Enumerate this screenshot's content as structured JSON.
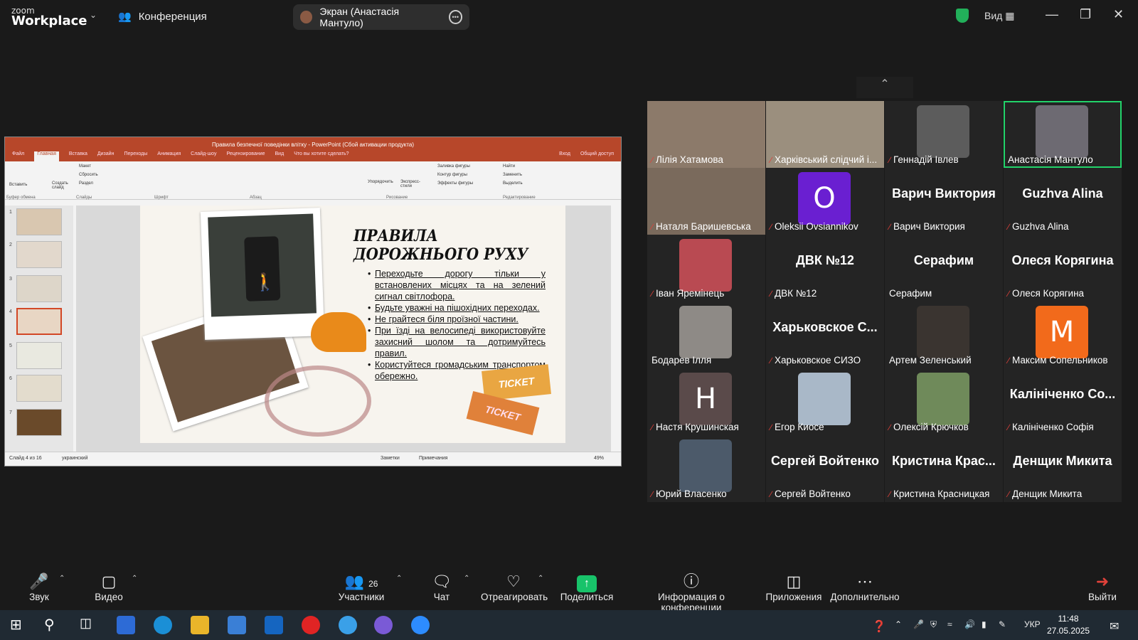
{
  "topbar": {
    "logo_top": "zoom",
    "logo_bottom": "Workplace",
    "conference_label": "Конференция",
    "share_label": "Экран (Анастасія Мантуло)",
    "view_label": "Вид"
  },
  "ppt": {
    "title": "Правила безпечної поведінки влітку - PowerPoint (Сбой активации продукта)",
    "tabs": [
      "Файл",
      "Главная",
      "Вставка",
      "Дизайн",
      "Переходы",
      "Анимация",
      "Слайд-шоу",
      "Рецензирование",
      "Вид",
      "Что вы хотите сделать?"
    ],
    "right_tabs": [
      "Вход",
      "Общий доступ"
    ],
    "groups": [
      "Буфер обмена",
      "Слайды",
      "Шрифт",
      "Абзац",
      "Рисование",
      "Редактирование"
    ],
    "ribbon_items": [
      "Вставить",
      "Создать слайд",
      "Макет",
      "Сбросить",
      "Раздел",
      "Упорядочить",
      "Экспресс-стили",
      "Заливка фигуры",
      "Контур фигуры",
      "Эффекты фигуры",
      "Найти",
      "Заменить",
      "Выделить"
    ],
    "thumb_numbers": [
      "1",
      "2",
      "3",
      "4",
      "5",
      "6",
      "7"
    ],
    "slide": {
      "title": "ПРАВИЛА ДОРОЖНЬОГО РУХУ",
      "bullets": [
        "Переходьте дорогу тільки у встановлених місцях та на зелений сигнал світлофора.",
        "Будьте уважні на пішохідних переходах.",
        "Не грайтеся біля проїзної частини.",
        "При їзді на велосипеді використовуйте захисний шолом та дотримуйтесь правил.",
        "Користуйтеся громадським транспортом обережно."
      ],
      "ticket1": "TICKET",
      "ticket2": "TICKET"
    },
    "status": {
      "slide_of": "Слайд 4 из 16",
      "language": "украинский",
      "notes": "Заметки",
      "comments": "Примечания",
      "zoom": "49%"
    }
  },
  "gallery": [
    {
      "name": "Лілія Хатамова",
      "type": "photo",
      "color": "#8c7a6a",
      "muted": true
    },
    {
      "name": "Харківський слідчий і...",
      "type": "photo",
      "color": "#9b8f7e",
      "muted": true
    },
    {
      "name": "Геннадій Івлев",
      "type": "photo_sq",
      "color": "#5c5c5c",
      "muted": true
    },
    {
      "name": "Анастасія Мантуло",
      "type": "photo_sq",
      "color": "#6d6a72",
      "muted": false,
      "active": true
    },
    {
      "name": "Наталя Баришевська",
      "type": "photo",
      "color": "#7a6a5c",
      "muted": true
    },
    {
      "name": "Oleksii Ovsiannikov",
      "type": "letter",
      "letter": "O",
      "color": "#6a1fd1",
      "muted": true
    },
    {
      "name": "Варич Виктория",
      "type": "text",
      "big": "Варич Виктория",
      "muted": true
    },
    {
      "name": "Guzhva Alina",
      "type": "text",
      "big": "Guzhva Alina",
      "muted": true
    },
    {
      "name": "Іван Яремінець",
      "type": "photo_sq",
      "color": "#b94a52",
      "muted": true
    },
    {
      "name": "ДВК №12",
      "type": "text",
      "big": "ДВК №12",
      "muted": true
    },
    {
      "name": "Серафим",
      "type": "text",
      "big": "Серафим",
      "muted": false
    },
    {
      "name": "Олеся Корягина",
      "type": "text",
      "big": "Олеся Корягина",
      "muted": true
    },
    {
      "name": "Бодарев Ілля",
      "type": "photo_sq",
      "color": "#8e8a86",
      "muted": false
    },
    {
      "name": "Харьковское СИЗО",
      "type": "text",
      "big": "Харьковское С...",
      "muted": true
    },
    {
      "name": "Артем Зеленський",
      "type": "photo_sq",
      "color": "#3a3430",
      "muted": false
    },
    {
      "name": "Максим Сопельников",
      "type": "letter",
      "letter": "M",
      "color": "#f26a1b",
      "muted": true
    },
    {
      "name": "Настя Крушинская",
      "type": "letter",
      "letter": "H",
      "color": "#5a4a4a",
      "muted": true
    },
    {
      "name": "Егор Киосе",
      "type": "photo_sq",
      "color": "#a9b8c8",
      "muted": true
    },
    {
      "name": "Олексій Крючков",
      "type": "photo_sq",
      "color": "#6f8a5a",
      "muted": true
    },
    {
      "name": "Калініченко Софія",
      "type": "text",
      "big": "Калініченко Со...",
      "muted": true
    },
    {
      "name": "Юрий Власенко",
      "type": "photo_sq",
      "color": "#4c5a6a",
      "muted": true
    },
    {
      "name": "Сергей Войтенко",
      "type": "text",
      "big": "Сергей Войтенко",
      "muted": true
    },
    {
      "name": "Кристина Красницкая",
      "type": "text",
      "big": "Кристина Крас...",
      "muted": true
    },
    {
      "name": "Денщик Микита",
      "type": "text",
      "big": "Денщик Микита",
      "muted": true
    }
  ],
  "toolbar": {
    "audio": "Звук",
    "video": "Видео",
    "participants": "Участники",
    "participants_count": "26",
    "chat": "Чат",
    "react": "Отреагировать",
    "share": "Поделиться",
    "info": "Информация о конференции",
    "apps": "Приложения",
    "more": "Дополнительно",
    "leave": "Выйти"
  },
  "taskbar": {
    "lang": "УКР",
    "time": "11:48",
    "date": "27.05.2025"
  }
}
